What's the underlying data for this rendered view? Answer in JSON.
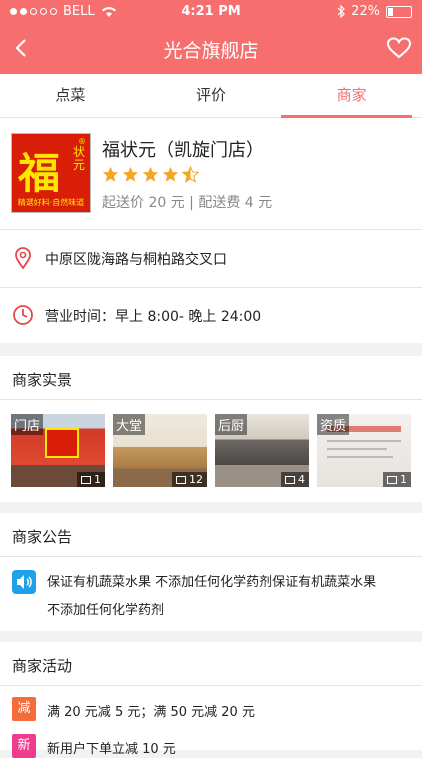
{
  "status_bar": {
    "carrier": "BELL",
    "time": "4:21 PM",
    "battery": "22%"
  },
  "header": {
    "title": "光合旗舰店"
  },
  "tabs": [
    {
      "label": "点菜"
    },
    {
      "label": "评价"
    },
    {
      "label": "商家"
    }
  ],
  "store": {
    "name": "福状元（凯旋门店）",
    "rating": 4.5,
    "fee_text": "起送价 20 元 | 配送费 4 元",
    "logo": {
      "main_char": "福",
      "side_text": "状元",
      "slogan": "精選好料·自然味道",
      "reg_mark": "®"
    }
  },
  "address": "中原区陇海路与桐柏路交叉口",
  "hours": "营业时间：早上 8:00- 晚上 24:00",
  "photos_section": {
    "title": "商家实景",
    "items": [
      {
        "label": "门店",
        "count": "1"
      },
      {
        "label": "大堂",
        "count": "12"
      },
      {
        "label": "后厨",
        "count": "4"
      },
      {
        "label": "资质",
        "count": "1"
      }
    ]
  },
  "notice_section": {
    "title": "商家公告",
    "line1": "保证有机蔬菜水果 不添加任何化学药剂保证有机蔬菜水果",
    "line2": "不添加任何化学药剂"
  },
  "activity_section": {
    "title": "商家活动",
    "items": [
      {
        "badge": "减",
        "text": "满 20 元减 5 元；满 50 元减 20 元",
        "color": "#f56c3c"
      },
      {
        "badge": "新",
        "text": "新用户下单立减 10 元",
        "color": "#f03c8c"
      }
    ]
  },
  "colors": {
    "accent": "#f76e6e",
    "star": "#f5a623"
  }
}
